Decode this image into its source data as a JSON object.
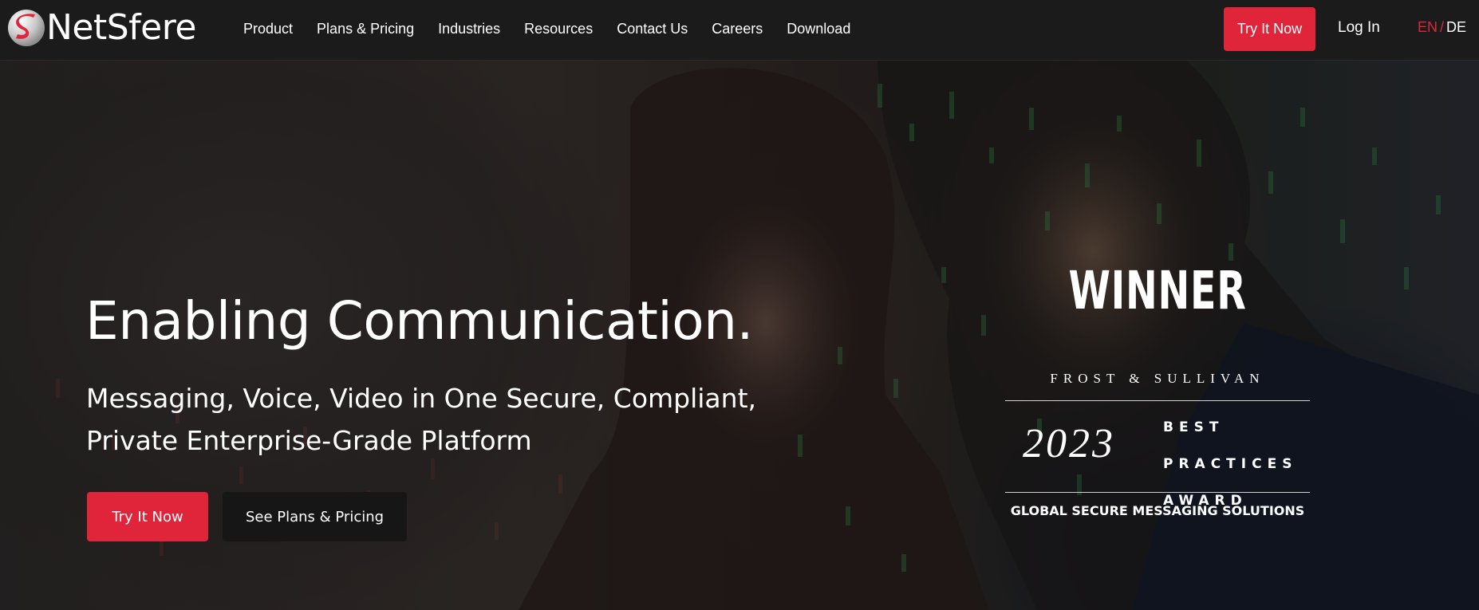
{
  "brand": {
    "name": "NetSfere",
    "logo_mark": "S"
  },
  "nav": {
    "items": [
      {
        "label": "Product"
      },
      {
        "label": "Plans & Pricing"
      },
      {
        "label": "Industries"
      },
      {
        "label": "Resources"
      },
      {
        "label": "Contact Us"
      },
      {
        "label": "Careers"
      },
      {
        "label": "Download"
      }
    ],
    "try_label": "Try It Now",
    "login_label": "Log In",
    "lang": {
      "en": "EN",
      "separator": "/",
      "de": "DE",
      "active": "EN"
    }
  },
  "hero": {
    "title": "Enabling Communication.",
    "subtitle": "Messaging, Voice, Video in One Secure, Compliant, Private Enterprise-Grade Platform",
    "cta_primary": "Try It Now",
    "cta_secondary": "See Plans & Pricing"
  },
  "award": {
    "headline": "WINNER",
    "organization": "FROST & SULLIVAN",
    "year": "2023",
    "line1": "BEST",
    "line2": "PRACTICES",
    "line3": "AWARD",
    "category": "GLOBAL SECURE MESSAGING SOLUTIONS"
  },
  "colors": {
    "accent": "#e0243a",
    "nav_bg": "#1b1b1b",
    "dark_button": "#161616",
    "text": "#ffffff"
  }
}
